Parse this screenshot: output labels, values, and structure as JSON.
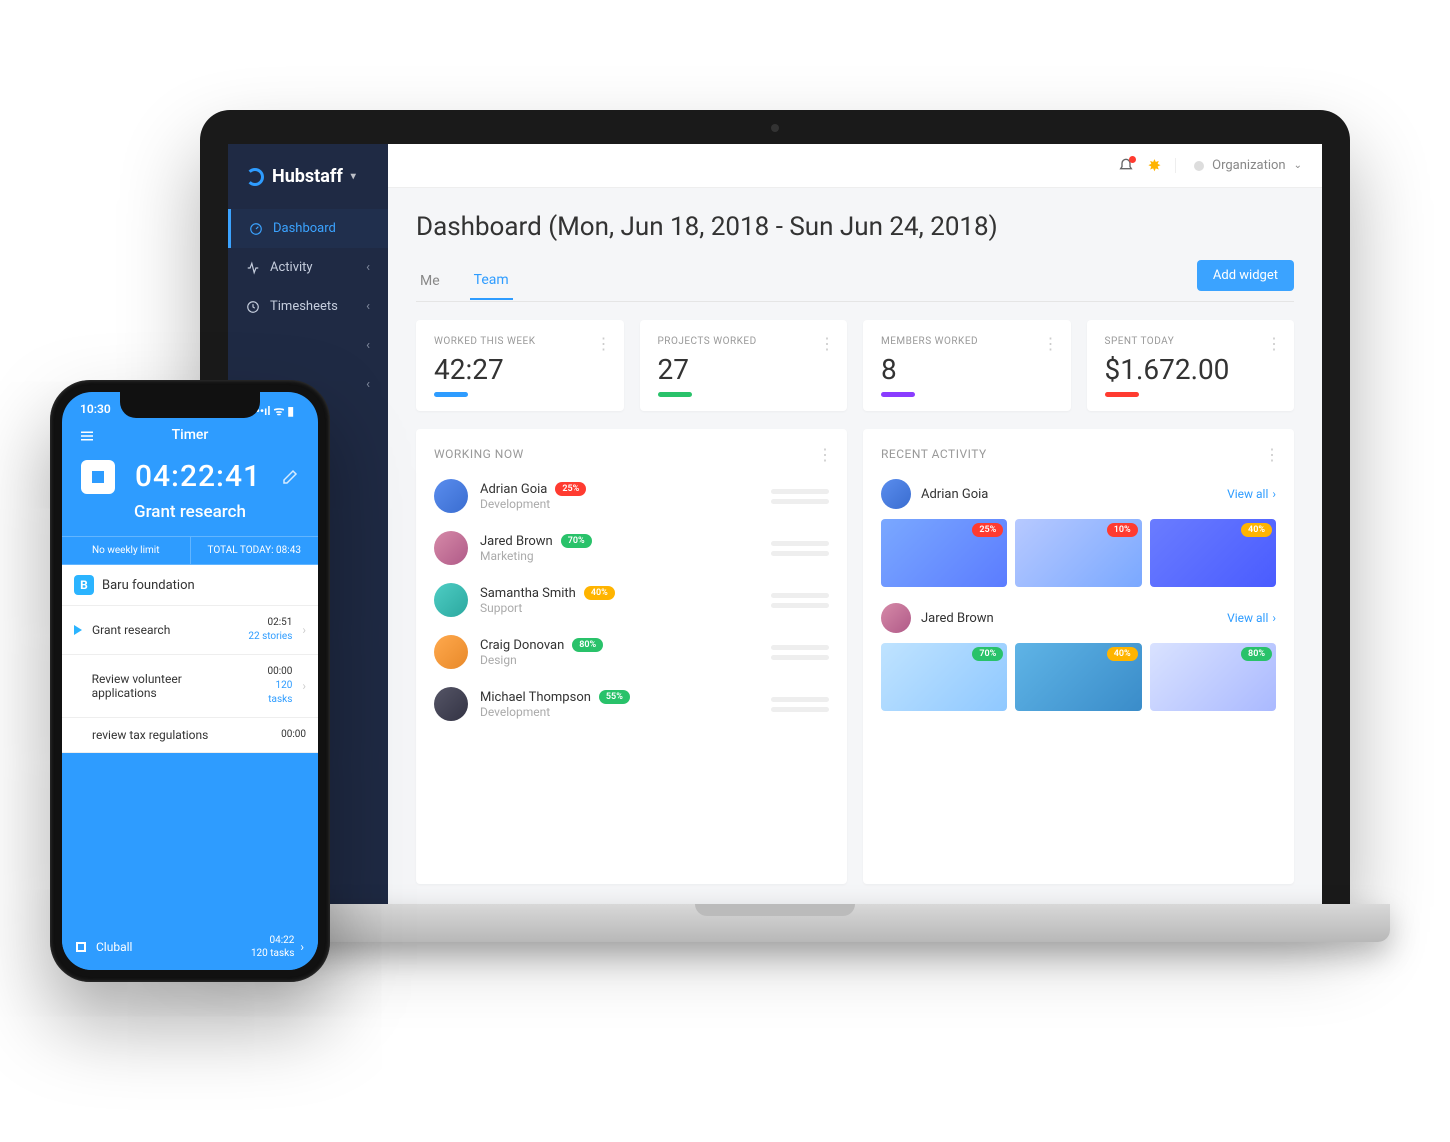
{
  "brand": "Hubstaff",
  "sidebar": {
    "items": [
      {
        "label": "Dashboard",
        "active": true
      },
      {
        "label": "Activity"
      },
      {
        "label": "Timesheets"
      },
      {
        "label": ""
      },
      {
        "label": ""
      }
    ]
  },
  "topbar": {
    "org_label": "Organization"
  },
  "dashboard": {
    "title": "Dashboard (Mon, Jun 18, 2018 - Sun Jun 24, 2018)",
    "tabs": {
      "me": "Me",
      "team": "Team"
    },
    "add_widget": "Add widget"
  },
  "stats": [
    {
      "label": "WORKED THIS WEEK",
      "value": "42:27",
      "color": "#2e9cff"
    },
    {
      "label": "PROJECTS WORKED",
      "value": "27",
      "color": "#29c26a"
    },
    {
      "label": "MEMBERS WORKED",
      "value": "8",
      "color": "#8a3cff"
    },
    {
      "label": "SPENT TODAY",
      "value": "$1.672.00",
      "color": "#ff3b30"
    }
  ],
  "working_now": {
    "title": "WORKING NOW",
    "rows": [
      {
        "name": "Adrian Goia",
        "dept": "Development",
        "pct": "25%",
        "color": "#ff3b30",
        "av": "av1"
      },
      {
        "name": "Jared Brown",
        "dept": "Marketing",
        "pct": "70%",
        "color": "#29c26a",
        "av": "av2"
      },
      {
        "name": "Samantha Smith",
        "dept": "Support",
        "pct": "40%",
        "color": "#ffb400",
        "av": "av3"
      },
      {
        "name": "Craig Donovan",
        "dept": "Design",
        "pct": "80%",
        "color": "#29c26a",
        "av": "av4"
      },
      {
        "name": "Michael Thompson",
        "dept": "Development",
        "pct": "55%",
        "color": "#29c26a",
        "av": "av5"
      }
    ]
  },
  "recent_activity": {
    "title": "RECENT ACTIVITY",
    "view_all": "View all",
    "rows": [
      {
        "name": "Adrian Goia",
        "av": "av1",
        "shots": [
          {
            "pct": "25%",
            "c": "#ff3b30",
            "bg": "shot1"
          },
          {
            "pct": "10%",
            "c": "#ff3b30",
            "bg": "shot2"
          },
          {
            "pct": "40%",
            "c": "#ffb400",
            "bg": "shot3"
          }
        ]
      },
      {
        "name": "Jared Brown",
        "av": "av2",
        "shots": [
          {
            "pct": "70%",
            "c": "#29c26a",
            "bg": "shot4"
          },
          {
            "pct": "40%",
            "c": "#ffb400",
            "bg": "shot5"
          },
          {
            "pct": "80%",
            "c": "#29c26a",
            "bg": "shot6"
          }
        ]
      }
    ]
  },
  "phone": {
    "status_time": "10:30",
    "title": "Timer",
    "timer": "04:22:41",
    "project": "Grant research",
    "limit_left": "No weekly limit",
    "limit_right": "TOTAL TODAY: 08:43",
    "project_header": {
      "badge": "B",
      "name": "Baru foundation"
    },
    "tasks": [
      {
        "name": "Grant research",
        "time": "02:51",
        "sub": "22 stories",
        "playing": true
      },
      {
        "name": "Review volunteer applications",
        "time": "00:00",
        "sub": "120 tasks",
        "playing": false
      },
      {
        "name": "review tax regulations",
        "time": "00:00",
        "sub": "",
        "playing": false
      }
    ],
    "footer": {
      "name": "Cluball",
      "time": "04:22",
      "sub": "120 tasks"
    }
  }
}
